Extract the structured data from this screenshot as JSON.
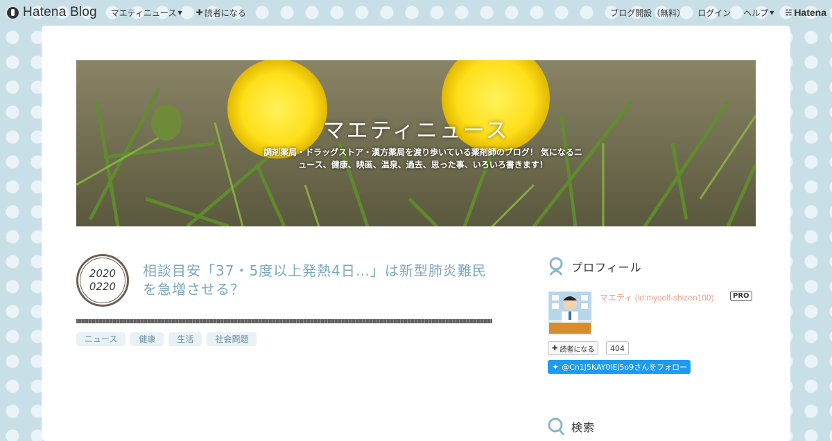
{
  "topbar": {
    "logo_text": "Hatena Blog",
    "nav_blog_menu": "マエティニュース",
    "nav_subscribe": "読者になる",
    "nav_open_blog": "ブログ開設（無料）",
    "nav_login": "ログイン",
    "nav_help": "ヘルプ",
    "hatena_label": "Hatena"
  },
  "header": {
    "title": "マエティニュース",
    "description": "調剤薬局・ドラッグストア・漢方薬局を渡り歩いている薬剤師のブログ！ 気になるニュース、健康、映画、温泉、過去、思った事、いろいろ書きます！"
  },
  "entry": {
    "date_year": "2020",
    "date_md": "0220",
    "title": "相談目安「37・5度以上発熱4日…」は新型肺炎難民を急増させる？",
    "tags": [
      "ニュース",
      "健康",
      "生活",
      "社会問題"
    ]
  },
  "sidebar": {
    "profile_title": "プロフィール",
    "profile_name": "マエティ (id:myself-shizen100)",
    "pro_badge": "PRO",
    "subscribe_label": "読者になる",
    "subscriber_count": "404",
    "follow_label": "@Cn1J5KAY0lEj5o9さんをフォロー",
    "search_title": "検索"
  },
  "colors": {
    "accent_title": "#7ba7bf",
    "profile_name": "#e8a28f",
    "twitter_blue": "#1d9bf0",
    "page_bg": "#c9dfe8"
  }
}
